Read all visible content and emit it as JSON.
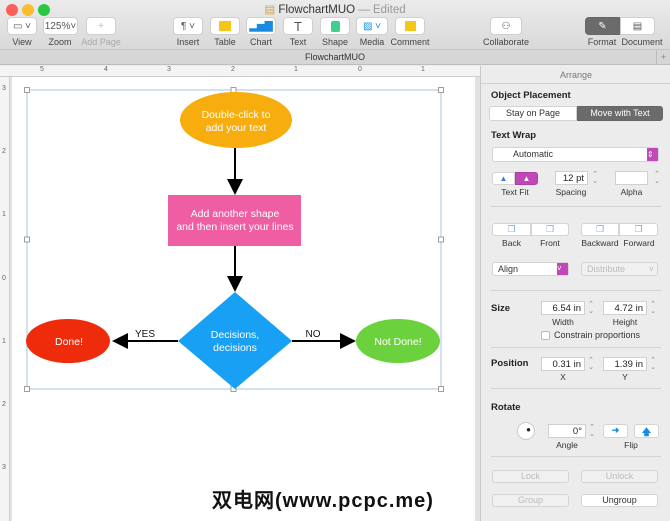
{
  "window": {
    "title": "FlowchartMUO",
    "status": "— Edited",
    "tab": "FlowchartMUO"
  },
  "toolbar": {
    "view": "View",
    "zoom_value": "125%",
    "zoom": "Zoom",
    "add_page": "Add Page",
    "insert": "Insert",
    "table": "Table",
    "chart": "Chart",
    "text": "Text",
    "shape": "Shape",
    "media": "Media",
    "comment": "Comment",
    "collaborate": "Collaborate",
    "format": "Format",
    "document": "Document"
  },
  "ruler": {
    "top": [
      "5",
      "4",
      "3",
      "2",
      "1",
      "0",
      "1"
    ],
    "left": [
      "3",
      "2",
      "1",
      "0",
      "1",
      "2",
      "3"
    ]
  },
  "flowchart": {
    "start": "Double-click to add your text",
    "process": "Add another shape and then insert your lines",
    "decision": "Decisions, decisions",
    "yes_label": "YES",
    "no_label": "NO",
    "done": "Done!",
    "not_done": "Not Done!",
    "colors": {
      "start": "#f7ad0e",
      "process": "#ef5da3",
      "decision": "#17a0f4",
      "done": "#ee2c0c",
      "not_done": "#6bd23e"
    }
  },
  "panel": {
    "tab": "Arrange",
    "object_placement": "Object Placement",
    "stay_on_page": "Stay on Page",
    "move_with_text": "Move with Text",
    "text_wrap": "Text Wrap",
    "wrap_value": "Automatic",
    "text_fit": "Text Fit",
    "spacing_value": "12 pt",
    "spacing": "Spacing",
    "alpha": "Alpha",
    "back": "Back",
    "front": "Front",
    "backward": "Backward",
    "forward": "Forward",
    "align": "Align",
    "distribute": "Distribute",
    "size": "Size",
    "width_value": "6.54 in",
    "width": "Width",
    "height_value": "4.72 in",
    "height": "Height",
    "constrain": "Constrain proportions",
    "position": "Position",
    "x_value": "0.31 in",
    "x": "X",
    "y_value": "1.39 in",
    "y": "Y",
    "rotate": "Rotate",
    "angle_value": "0°",
    "angle": "Angle",
    "flip": "Flip",
    "lock": "Lock",
    "unlock": "Unlock",
    "group": "Group",
    "ungroup": "Ungroup",
    "accent": "#c148b8"
  },
  "watermark": "双电网(www.pcpc.me)"
}
